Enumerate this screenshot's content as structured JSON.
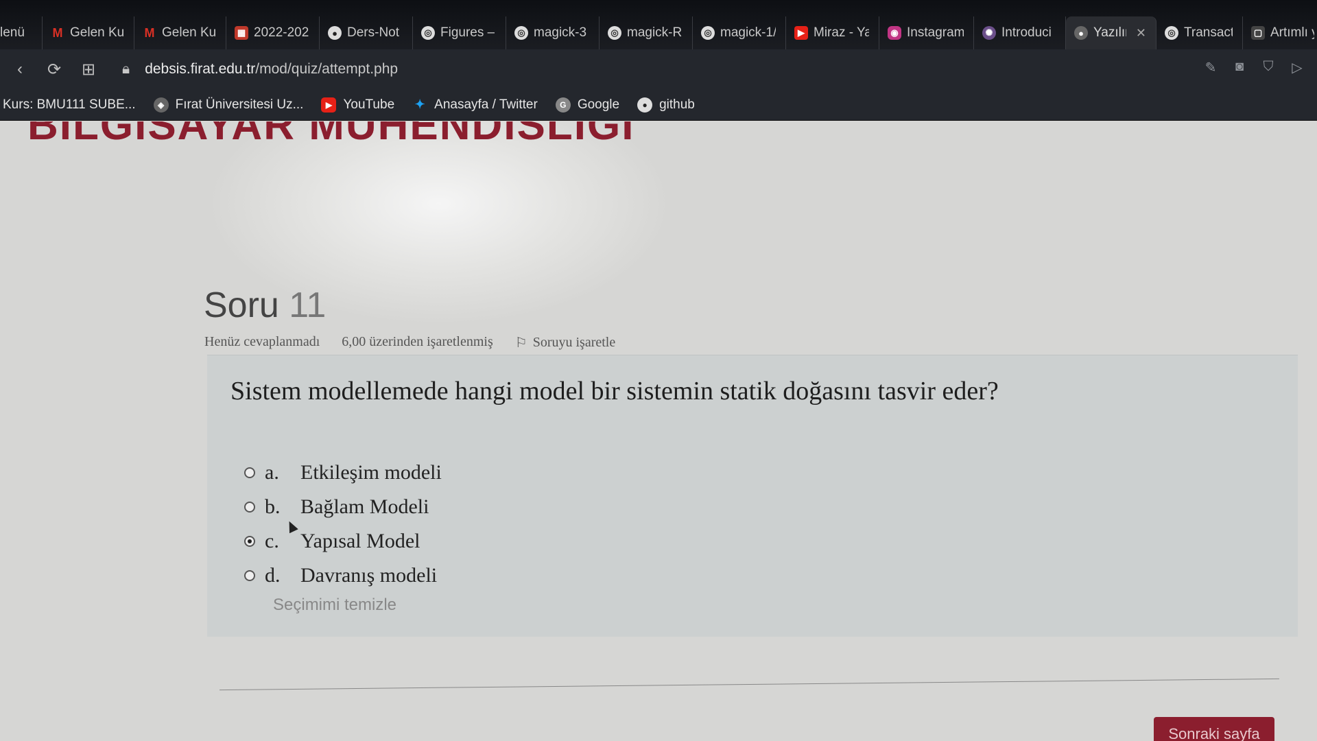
{
  "tabs": [
    {
      "label": "lenü",
      "icon": "menu-icon",
      "color": "#000000"
    },
    {
      "label": "Gelen Ku",
      "icon": "gmail-icon",
      "color": "#d93025"
    },
    {
      "label": "Gelen Ku",
      "icon": "gmail-icon",
      "color": "#d93025"
    },
    {
      "label": "2022-202",
      "icon": "calendar-icon",
      "color": "#c0392b"
    },
    {
      "label": "Ders-Not",
      "icon": "github-icon",
      "color": "#333333"
    },
    {
      "label": "Figures –",
      "icon": "globe-icon",
      "color": "#555555"
    },
    {
      "label": "magick-3",
      "icon": "globe-icon",
      "color": "#555555"
    },
    {
      "label": "magick-R",
      "icon": "globe-icon",
      "color": "#555555"
    },
    {
      "label": "magick-1/",
      "icon": "globe-icon",
      "color": "#555555"
    },
    {
      "label": "Miraz - Ya",
      "icon": "youtube-icon",
      "color": "#e62117"
    },
    {
      "label": "Instagram",
      "icon": "instagram-icon",
      "color": "#c13584"
    },
    {
      "label": "Introduci",
      "icon": "globe-icon",
      "color": "#6b4f8a"
    },
    {
      "label": "Yazılım",
      "icon": "site-icon",
      "color": "#666666",
      "active": true
    },
    {
      "label": "Transacti",
      "icon": "globe-icon",
      "color": "#555555"
    },
    {
      "label": "Artımlı y",
      "icon": "page-icon",
      "color": "#444444"
    }
  ],
  "address": {
    "domain": "debsis.firat.edu.tr",
    "path": "/mod/quiz/attempt.php"
  },
  "bookmarks": [
    {
      "label": "Kurs: BMU111 SUBE...",
      "icon": ""
    },
    {
      "label": "Fırat Üniversitesi Uz...",
      "icon": "firat-icon",
      "color": "#555555"
    },
    {
      "label": "YouTube",
      "icon": "youtube-icon",
      "color": "#e62117"
    },
    {
      "label": "Anasayfa / Twitter",
      "icon": "twitter-icon",
      "color": "#1da1f2"
    },
    {
      "label": "Google",
      "icon": "google-icon",
      "color": "#777777"
    },
    {
      "label": "github",
      "icon": "github-icon",
      "color": "#333333"
    }
  ],
  "page": {
    "department_title": "BILGISAYAR MÜHENDISLIĞI",
    "question_label": "Soru",
    "question_number": "11",
    "status": "Henüz cevaplanmadı",
    "marks": "6,00 üzerinden işaretlenmiş",
    "flag_label": "Soruyu işaretle",
    "question_text": "Sistem modellemede hangi model bir sistemin statik doğasını tasvir eder?",
    "answers": [
      {
        "letter": "a.",
        "text": "Etkileşim modeli",
        "selected": false
      },
      {
        "letter": "b.",
        "text": "Bağlam Modeli",
        "selected": false
      },
      {
        "letter": "c.",
        "text": "Yapısal Model",
        "selected": true
      },
      {
        "letter": "d.",
        "text": "Davranış modeli",
        "selected": false
      }
    ],
    "clear_choice": "Seçimimi temizle",
    "next_button": "Sonraki sayfa"
  },
  "colors": {
    "brand": "#8b1e2e"
  }
}
